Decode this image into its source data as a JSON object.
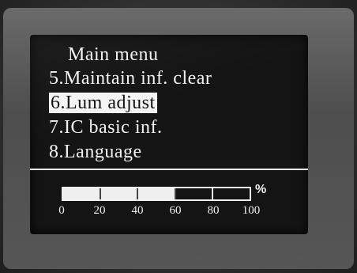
{
  "menu": {
    "title": "Main menu",
    "items": [
      {
        "label": "5.Maintain inf. clear",
        "selected": false
      },
      {
        "label": "6.Lum adjust",
        "selected": true
      },
      {
        "label": "7.IC basic inf.",
        "selected": false
      },
      {
        "label": "8.Language",
        "selected": false
      }
    ]
  },
  "luminance": {
    "level_percent": 60,
    "unit": "%",
    "ticks": [
      "0",
      "20",
      "40",
      "60",
      "80",
      "100"
    ]
  },
  "colors": {
    "screen_bg": "#141414",
    "foreground": "#f2f2f2"
  }
}
